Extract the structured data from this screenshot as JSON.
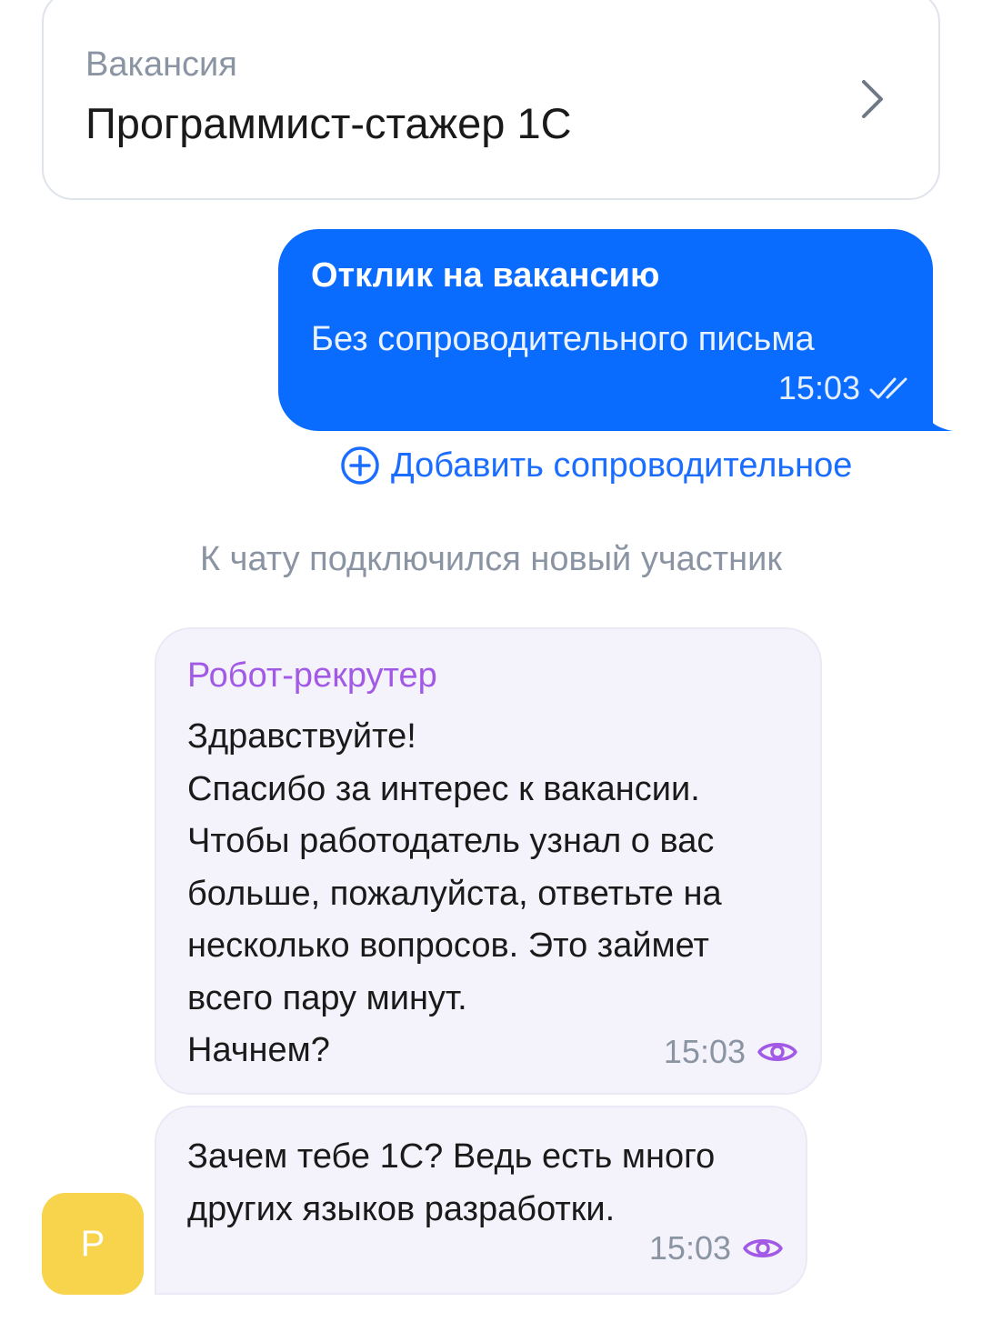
{
  "vacancy": {
    "caption": "Вакансия",
    "title": "Программист-стажер 1С",
    "chevron_icon": "chevron-right-icon"
  },
  "outgoing": {
    "title": "Отклик на вакансию",
    "text": "Без сопроводительного письма",
    "time": "15:03",
    "status_icon": "double-check-icon",
    "color": "#0a6cff"
  },
  "add_cover_letter": {
    "label": "Добавить сопроводительное",
    "icon": "plus-circle-icon",
    "color": "#1a6dff"
  },
  "system_note": "К чату подключился новый участник",
  "bot_message": {
    "sender": "Робот-рекрутер",
    "sender_color": "#a259e6",
    "lines": [
      "Здравствуйте!",
      "Спасибо за интерес к вакансии.",
      "Чтобы работодатель узнал о вас",
      "больше, пожалуйста, ответьте на",
      "несколько вопросов. Это займет",
      "всего пару минут.",
      "Начнем?"
    ],
    "time": "15:03",
    "status_icon": "eye-icon"
  },
  "incoming_message": {
    "lines": [
      "Зачем тебе 1С? Ведь есть много",
      "других языков разработки."
    ],
    "time": "15:03",
    "status_icon": "eye-icon",
    "avatar_letter": "Р",
    "avatar_color": "#f7d44c"
  }
}
